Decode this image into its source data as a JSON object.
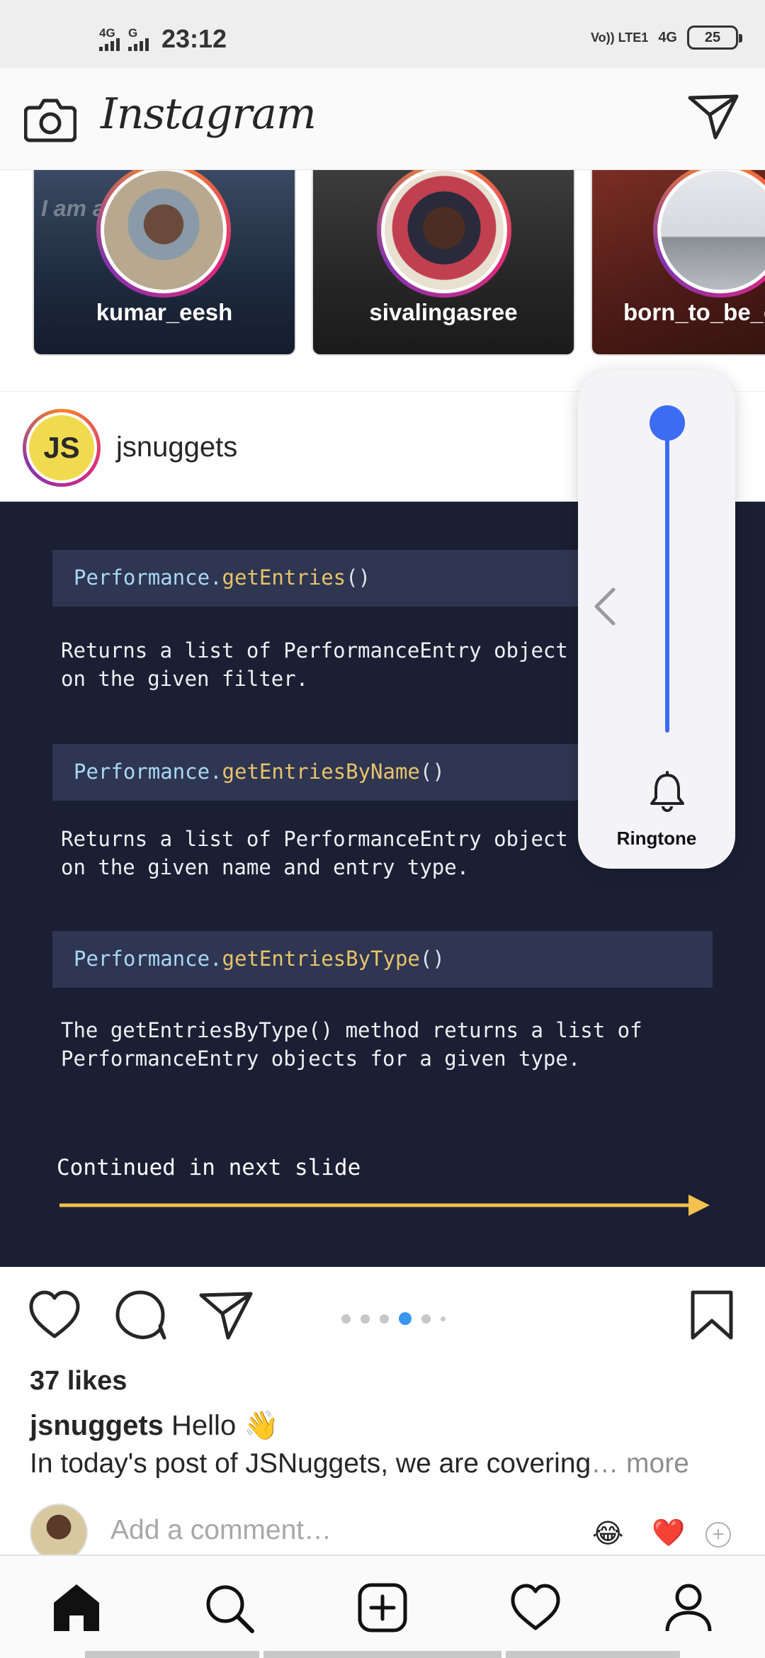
{
  "status_bar": {
    "network_1": "4G",
    "network_2": "G",
    "time": "23:12",
    "volte": "Vo)) LTE1",
    "network_right": "4G",
    "battery": "25"
  },
  "header": {
    "brand": "Instagram",
    "camera_icon": "camera-icon",
    "direct_icon": "paper-plane-icon"
  },
  "stories": [
    {
      "username": "kumar_eesh",
      "bg_text": "I am a     e egg"
    },
    {
      "username": "sivalingasree",
      "bg_text": ""
    },
    {
      "username": "born_to_be_e",
      "bg_text": ""
    }
  ],
  "post": {
    "username": "jsnuggets",
    "avatar_text": "JS",
    "slides": {
      "items": [
        {
          "object": "Performance",
          "method": "getEntries",
          "parens": "()",
          "desc": "Returns a list of PerformanceEntry object\non the given filter."
        },
        {
          "object": "Performance",
          "method": "getEntriesByName",
          "parens": "()",
          "desc": "Returns a list of PerformanceEntry object\non the given name and entry type."
        },
        {
          "object": "Performance",
          "method": "getEntriesByType",
          "parens": "()",
          "desc": "The getEntriesByType() method returns a list of\nPerformanceEntry objects for a given type."
        }
      ],
      "continued": "Continued in next slide"
    },
    "carousel": {
      "count": 6,
      "active_index": 3
    },
    "likes": "37 likes",
    "caption_user": "jsnuggets",
    "caption_text": "Hello 👋",
    "caption_line2": "In today's post of JSNuggets, we are covering",
    "caption_more": "… more",
    "comment_placeholder": "Add a comment…",
    "quick_emojis": [
      "😂",
      "❤️"
    ]
  },
  "volume_panel": {
    "label": "Ringtone",
    "level": 1.0,
    "accent": "#3d6cf4"
  },
  "bottom_nav": [
    "home-icon",
    "search-icon",
    "add-post-icon",
    "activity-heart-icon",
    "profile-icon"
  ],
  "colors": {
    "post_bg": "#1a1f33",
    "code_bg": "#2e3652",
    "method": "#e8c36a",
    "object": "#a9d7f3",
    "arrow": "#f2c14e",
    "carousel_active": "#3897f0"
  }
}
